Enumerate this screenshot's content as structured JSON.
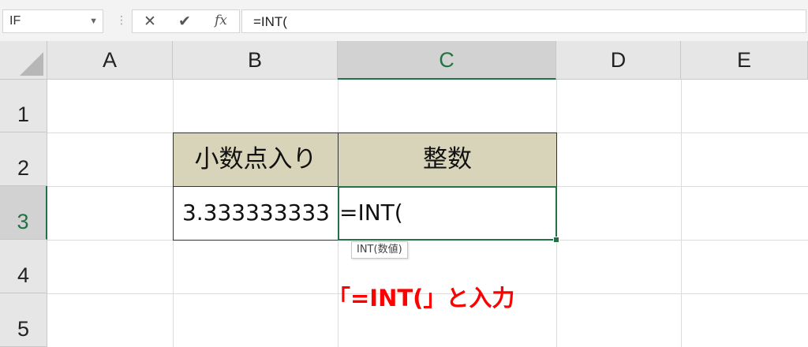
{
  "formula_bar": {
    "name_box_value": "IF",
    "cancel_glyph": "✕",
    "enter_glyph": "✔",
    "function_glyph": "fx",
    "formula_text": "=INT("
  },
  "columns": [
    {
      "label": "A",
      "selected": false
    },
    {
      "label": "B",
      "selected": false
    },
    {
      "label": "C",
      "selected": true
    },
    {
      "label": "D",
      "selected": false
    },
    {
      "label": "E",
      "selected": false
    }
  ],
  "rows": [
    {
      "label": "1",
      "selected": false
    },
    {
      "label": "2",
      "selected": false
    },
    {
      "label": "3",
      "selected": true
    },
    {
      "label": "4",
      "selected": false
    },
    {
      "label": "5",
      "selected": false
    }
  ],
  "table": {
    "header_b": "小数点入り",
    "header_c": "整数",
    "value_b3": "3.333333333",
    "editing_c3": "=INT("
  },
  "tooltip_text": "INT(数値)",
  "annotation_text": "「=INT(」と入力",
  "colors": {
    "accent": "#217346",
    "header_fill": "#d8d4b9",
    "annotation": "#ff0000"
  }
}
